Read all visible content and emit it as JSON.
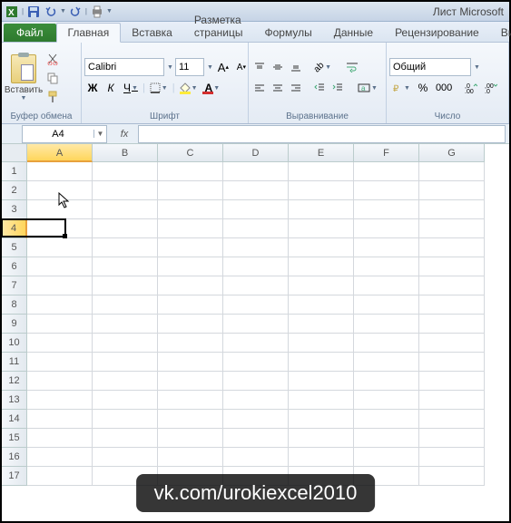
{
  "title": "Лист Microsoft",
  "qat": {
    "save": "save",
    "undo": "undo",
    "redo": "redo",
    "print": "print"
  },
  "tabs": {
    "file": "Файл",
    "items": [
      "Главная",
      "Вставка",
      "Разметка страницы",
      "Формулы",
      "Данные",
      "Рецензирование",
      "Ви"
    ],
    "active": 0
  },
  "ribbon": {
    "clipboard": {
      "paste": "Вставить",
      "label": "Буфер обмена"
    },
    "font": {
      "name": "Calibri",
      "size": "11",
      "bold": "Ж",
      "italic": "К",
      "underline": "Ч",
      "grow": "A",
      "shrink": "A",
      "label": "Шрифт"
    },
    "align": {
      "label": "Выравнивание"
    },
    "number": {
      "format": "Общий",
      "label": "Число"
    }
  },
  "namebox": "A4",
  "fx": "fx",
  "grid": {
    "cols": [
      "A",
      "B",
      "C",
      "D",
      "E",
      "F",
      "G"
    ],
    "rows": [
      "1",
      "2",
      "3",
      "4",
      "5",
      "6",
      "7",
      "8",
      "9",
      "10",
      "11",
      "12",
      "13",
      "14",
      "15",
      "16",
      "17"
    ],
    "selected_col": 0,
    "selected_row": 3
  },
  "watermark": "vk.com/urokiexcel2010"
}
